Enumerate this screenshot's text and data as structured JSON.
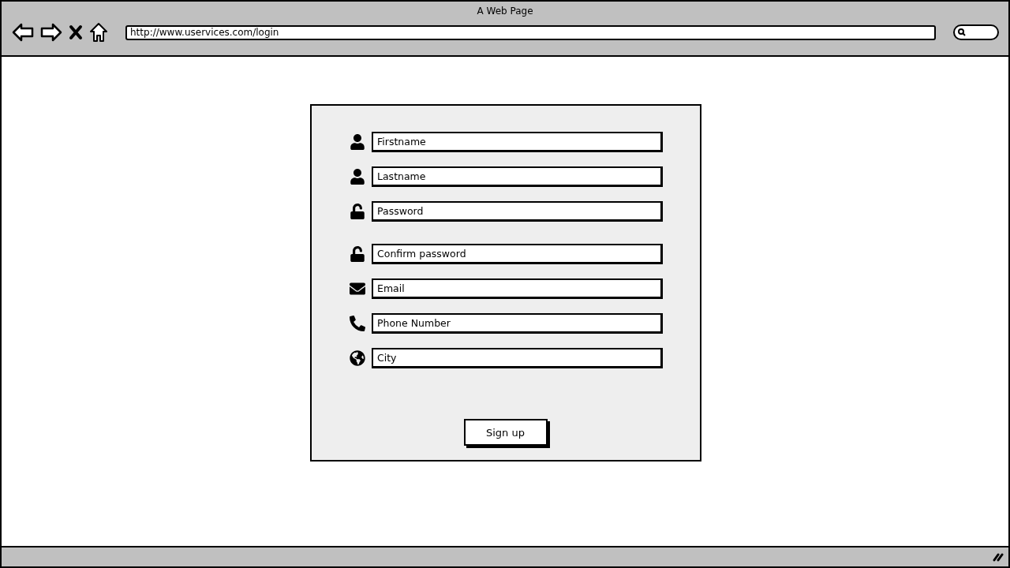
{
  "window": {
    "title": "A Web Page"
  },
  "address_bar": {
    "value": "http://www.uservices.com/login"
  },
  "form": {
    "fields": [
      {
        "kind": "person",
        "placeholder": "Firstname"
      },
      {
        "kind": "person",
        "placeholder": "Lastname"
      },
      {
        "kind": "lock",
        "placeholder": "Password"
      },
      {
        "kind": "lock",
        "placeholder": "Confirm password"
      },
      {
        "kind": "email",
        "placeholder": "Email"
      },
      {
        "kind": "phone",
        "placeholder": "Phone Number"
      },
      {
        "kind": "globe",
        "placeholder": "City"
      }
    ],
    "submit_button": "Sign up"
  }
}
